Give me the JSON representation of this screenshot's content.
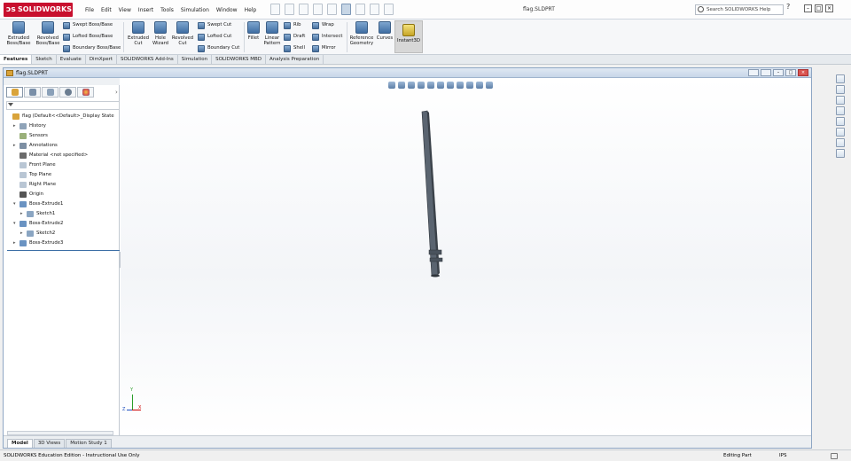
{
  "app": {
    "logo": "SOLIDWORKS",
    "document_title": "flag.SLDPRT"
  },
  "menu": [
    "File",
    "Edit",
    "View",
    "Insert",
    "Tools",
    "Simulation",
    "Window",
    "Help"
  ],
  "search": {
    "placeholder": "Search SOLIDWORKS Help"
  },
  "help_label": "?",
  "window_controls": [
    "–",
    "□",
    "×"
  ],
  "ribbon": {
    "extruded_boss": "Extruded Boss/Base",
    "revolved_boss": "Revolved Boss/Base",
    "swept_boss": "Swept Boss/Base",
    "lofted_boss": "Lofted Boss/Base",
    "boundary_boss": "Boundary Boss/Base",
    "extruded_cut": "Extruded Cut",
    "hole_wizard": "Hole Wizard",
    "revolved_cut": "Revolved Cut",
    "swept_cut": "Swept Cut",
    "lofted_cut": "Lofted Cut",
    "boundary_cut": "Boundary Cut",
    "fillet": "Fillet",
    "linear_pattern": "Linear Pattern",
    "rib": "Rib",
    "draft": "Draft",
    "shell": "Shell",
    "wrap": "Wrap",
    "intersect": "Intersect",
    "mirror": "Mirror",
    "reference_geometry": "Reference Geometry",
    "curves": "Curves",
    "instant3d": "Instant3D"
  },
  "command_tabs": [
    "Features",
    "Sketch",
    "Evaluate",
    "DimXpert",
    "SOLIDWORKS Add-Ins",
    "Simulation",
    "SOLIDWORKS MBD",
    "Analysis Preparation"
  ],
  "document_window": {
    "title": "flag.SLDPRT"
  },
  "tree": [
    {
      "label": "flag  (Default<<Default>_Display State",
      "level": 0,
      "expander": "",
      "icon": "part-icon"
    },
    {
      "label": "History",
      "level": 1,
      "expander": "▸",
      "icon": "history-icon"
    },
    {
      "label": "Sensors",
      "level": 1,
      "expander": "",
      "icon": "sensors-icon"
    },
    {
      "label": "Annotations",
      "level": 1,
      "expander": "▸",
      "icon": "annotations-icon"
    },
    {
      "label": "Material <not specified>",
      "level": 1,
      "expander": "",
      "icon": "material-icon"
    },
    {
      "label": "Front Plane",
      "level": 1,
      "expander": "",
      "icon": "plane-icon"
    },
    {
      "label": "Top Plane",
      "level": 1,
      "expander": "",
      "icon": "plane-icon"
    },
    {
      "label": "Right Plane",
      "level": 1,
      "expander": "",
      "icon": "plane-icon"
    },
    {
      "label": "Origin",
      "level": 1,
      "expander": "",
      "icon": "origin-icon"
    },
    {
      "label": "Boss-Extrude1",
      "level": 1,
      "expander": "▾",
      "icon": "extrude-icon"
    },
    {
      "label": "Sketch1",
      "level": 2,
      "expander": "▸",
      "icon": "sketch-icon"
    },
    {
      "label": "Boss-Extrude2",
      "level": 1,
      "expander": "▾",
      "icon": "extrude-icon"
    },
    {
      "label": "Sketch2",
      "level": 2,
      "expander": "▸",
      "icon": "sketch-icon"
    },
    {
      "label": "Boss-Extrude3",
      "level": 1,
      "expander": "▸",
      "icon": "extrude-icon"
    }
  ],
  "triad": {
    "x": "X",
    "y": "Y",
    "z": "Z"
  },
  "bottom_tabs": [
    "Model",
    "3D Views",
    "Motion Study 1"
  ],
  "status": {
    "left": "SOLIDWORKS Education Edition - Instructional Use Only",
    "mode": "Editing Part",
    "units": "IPS"
  },
  "colors": {
    "brand": "#c8102e",
    "accent": "#3b6ea5"
  }
}
